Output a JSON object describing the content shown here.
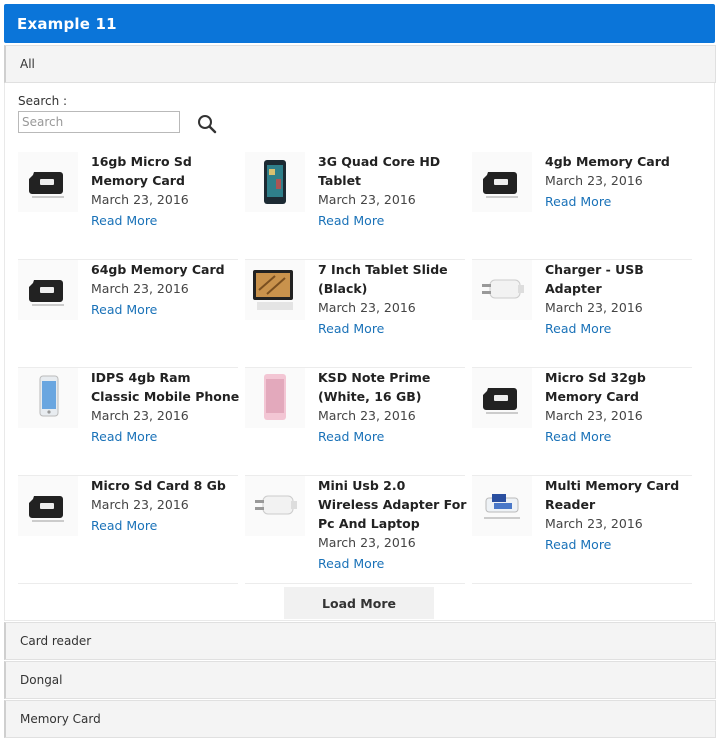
{
  "header": {
    "title": "Example 11"
  },
  "accordion": {
    "all_label": "All",
    "sections": [
      "Card reader",
      "Dongal",
      "Memory Card"
    ]
  },
  "search": {
    "label": "Search :",
    "placeholder": "Search"
  },
  "items": [
    {
      "title": "16gb Micro Sd Memory Card",
      "date": "March 23, 2016",
      "link": "Read More",
      "icon": "microsd-card"
    },
    {
      "title": "3G Quad Core HD Tablet",
      "date": "March 23, 2016",
      "link": "Read More",
      "icon": "tablet"
    },
    {
      "title": "4gb Memory Card",
      "date": "March 23, 2016",
      "link": "Read More",
      "icon": "microsd-card"
    },
    {
      "title": "64gb Memory Card",
      "date": "March 23, 2016",
      "link": "Read More",
      "icon": "microsd-card"
    },
    {
      "title": "7 Inch Tablet Slide (Black)",
      "date": "March 23, 2016",
      "link": "Read More",
      "icon": "tablet-slide"
    },
    {
      "title": "Charger - USB Adapter",
      "date": "March 23, 2016",
      "link": "Read More",
      "icon": "usb-charger"
    },
    {
      "title": "IDPS 4gb Ram Classic Mobile Phone",
      "date": "March 23, 2016",
      "link": "Read More",
      "icon": "phone-white"
    },
    {
      "title": "KSD Note Prime (White, 16 GB)",
      "date": "March 23, 2016",
      "link": "Read More",
      "icon": "phone-pink"
    },
    {
      "title": "Micro Sd 32gb Memory Card",
      "date": "March 23, 2016",
      "link": "Read More",
      "icon": "microsd-card"
    },
    {
      "title": "Micro Sd Card 8 Gb",
      "date": "March 23, 2016",
      "link": "Read More",
      "icon": "microsd-card"
    },
    {
      "title": "Mini Usb 2.0 Wireless Adapter For Pc And Laptop",
      "date": "March 23, 2016",
      "link": "Read More",
      "icon": "usb-charger"
    },
    {
      "title": "Multi Memory Card Reader",
      "date": "March 23, 2016",
      "link": "Read More",
      "icon": "card-reader"
    }
  ],
  "load_more_label": "Load More",
  "colors": {
    "header": "#0b75d9",
    "link": "#1a72b8"
  }
}
